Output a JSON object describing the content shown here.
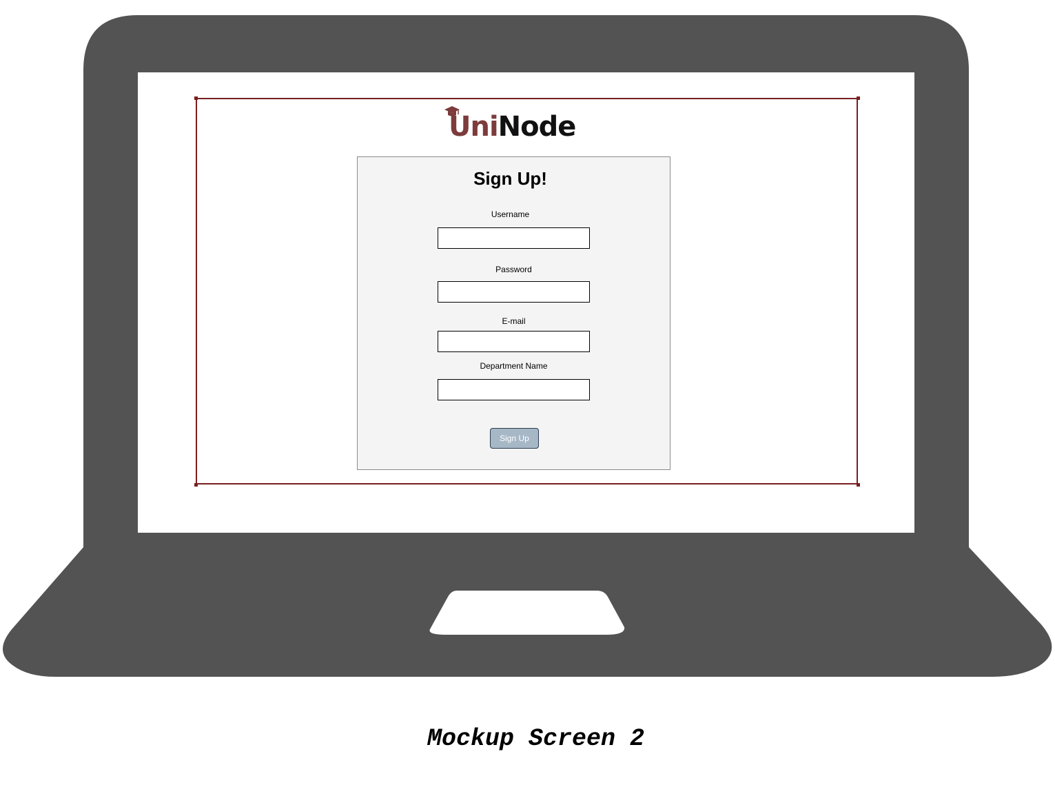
{
  "colors": {
    "laptop_body": "#535353",
    "frame_border": "#7a1e1e",
    "logo_uni": "#7d3b3b",
    "logo_node": "#111111",
    "card_background": "#f4f4f4",
    "button_background": "#a6b7c6"
  },
  "logo": {
    "part1": "Uni",
    "part2": "Node",
    "icon": "graduation-cap-icon"
  },
  "signup_form": {
    "title": "Sign Up!",
    "fields": [
      {
        "label": "Username",
        "value": ""
      },
      {
        "label": "Password",
        "value": ""
      },
      {
        "label": "E-mail",
        "value": ""
      },
      {
        "label": "Department Name",
        "value": ""
      }
    ],
    "submit_label": "Sign Up"
  },
  "caption": "Mockup Screen 2"
}
